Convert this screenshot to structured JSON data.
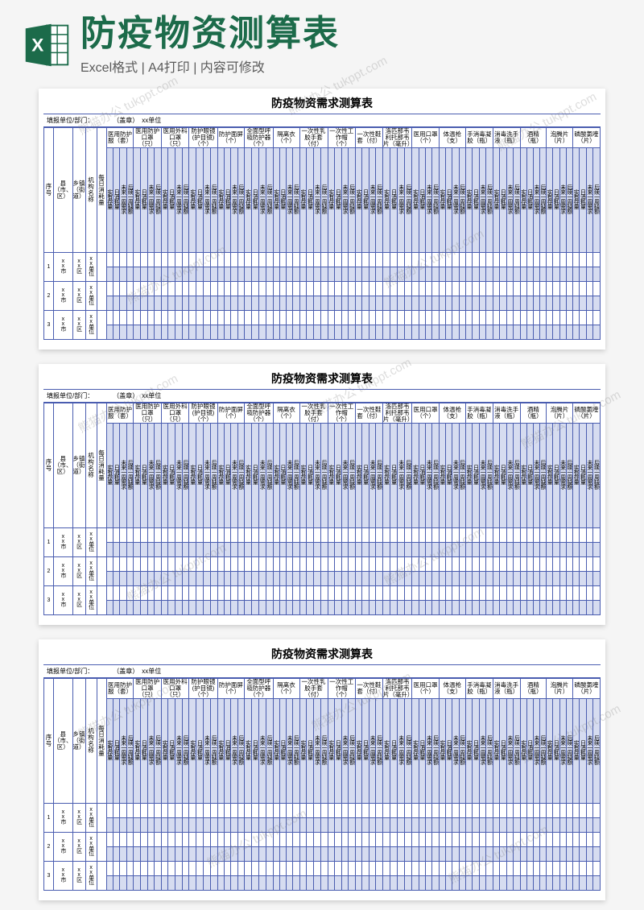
{
  "header": {
    "title": "防疫物资测算表",
    "subtitle": "Excel格式 | A4打印 | 内容可修改"
  },
  "watermark": "熊猫办公 tukppt.com",
  "table": {
    "title": "防疫物资需求测算表",
    "filler_label": "填报单位/部门：",
    "stamp_label": "（盖章）",
    "unit_name": "xx单位",
    "row_headers": {
      "seq": "序号",
      "county": "县（市、区）",
      "town": "乡镇（街道）",
      "org": "机构名称",
      "metric": "每日消耗量"
    },
    "item_headers": [
      "医用防护服（套）",
      "医用防护口罩（只）",
      "医用外科口罩（只）",
      "防护眼镜(护目镜)（个）",
      "防护面屏（个）",
      "全面型呼吸防护器（个）",
      "隔离衣（个）",
      "一次性乳胶手套（付）",
      "一次性工作帽（个）",
      "一次性鞋套（付）",
      "洛匹那韦利托那韦片（毫升）",
      "医用口罩（个）",
      "体温枪（支）",
      "手消毒凝胶（瓶）",
      "消毒洗手液（瓶）",
      "酒精（瓶）",
      "泡腾片（片）",
      "磷酸氯喹（片）"
    ],
    "sub_cols": [
      "实有存量",
      "日消耗量",
      "未来一周需求",
      "后续一周缺额"
    ],
    "data_rows": [
      {
        "seq": "1",
        "county": "xx市",
        "town": "xx区",
        "org": "xx单位"
      },
      {
        "seq": "2",
        "county": "xx市",
        "town": "xx区",
        "org": "xx单位"
      },
      {
        "seq": "3",
        "county": "xx市",
        "town": "xx区",
        "org": "xx单位"
      }
    ]
  }
}
